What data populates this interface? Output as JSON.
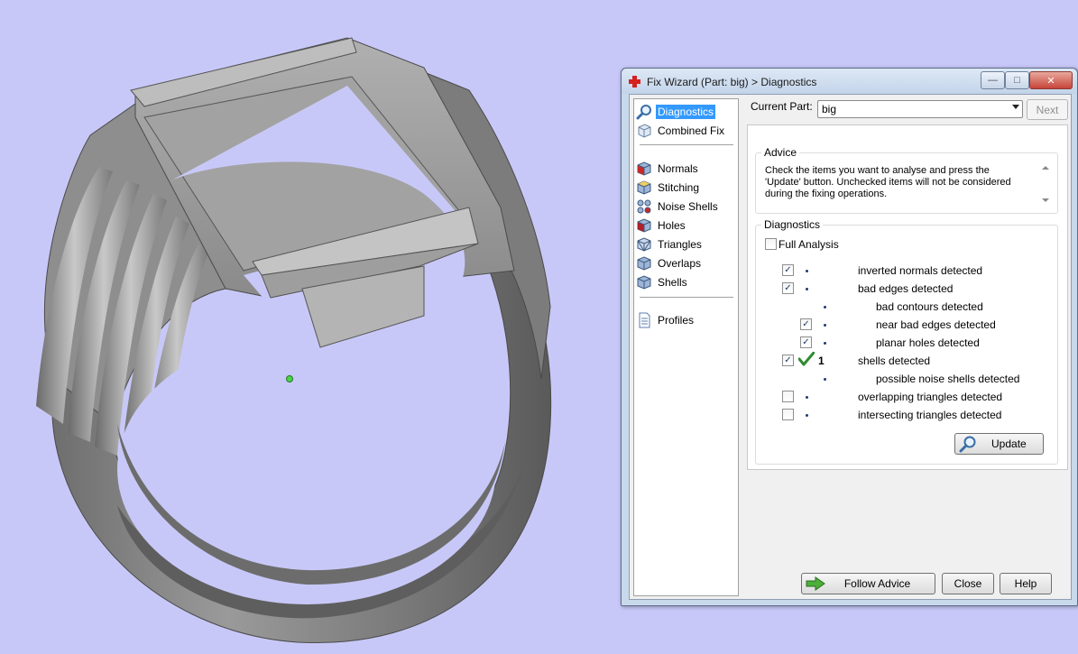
{
  "window": {
    "title": "Fix Wizard (Part: big) > Diagnostics",
    "controls": {
      "minimize": "—",
      "maximize": "□",
      "close": "✕"
    }
  },
  "nav": {
    "items": [
      {
        "label": "Diagnostics",
        "icon": "magnifier-icon",
        "selected": true
      },
      {
        "label": "Combined Fix",
        "icon": "combined-fix-icon"
      },
      {
        "label": "Normals",
        "icon": "normals-cube-icon"
      },
      {
        "label": "Stitching",
        "icon": "stitching-cube-icon"
      },
      {
        "label": "Noise Shells",
        "icon": "noise-shells-icon"
      },
      {
        "label": "Holes",
        "icon": "holes-cube-icon"
      },
      {
        "label": "Triangles",
        "icon": "triangles-cube-icon"
      },
      {
        "label": "Overlaps",
        "icon": "overlaps-cube-icon"
      },
      {
        "label": "Shells",
        "icon": "shells-cube-icon"
      },
      {
        "label": "Profiles",
        "icon": "profiles-document-icon"
      }
    ]
  },
  "header": {
    "current_part_label": "Current Part:",
    "current_part_value": "big",
    "next_label": "Next"
  },
  "advice": {
    "title": "Advice",
    "text": "Check the items you want to analyse and press the 'Update' button. Unchecked items will not be considered during the fixing operations."
  },
  "diagnostics": {
    "title": "Diagnostics",
    "full_analysis_label": "Full Analysis",
    "full_analysis_checked": false,
    "rows": [
      {
        "label": "inverted normals detected",
        "checked": true,
        "indent": 0,
        "count": ""
      },
      {
        "label": "bad edges detected",
        "checked": true,
        "indent": 0,
        "count": ""
      },
      {
        "label": "bad contours detected",
        "checked": null,
        "indent": 1,
        "count": ""
      },
      {
        "label": "near bad edges detected",
        "checked": true,
        "indent": 1,
        "count": ""
      },
      {
        "label": "planar holes detected",
        "checked": true,
        "indent": 1,
        "count": ""
      },
      {
        "label": "shells detected",
        "checked": true,
        "indent": 0,
        "count": "1",
        "ok": true
      },
      {
        "label": "possible noise shells detected",
        "checked": null,
        "indent": 1,
        "count": ""
      },
      {
        "label": "overlapping triangles detected",
        "checked": false,
        "indent": 0,
        "count": ""
      },
      {
        "label": "intersecting triangles detected",
        "checked": false,
        "indent": 0,
        "count": ""
      }
    ],
    "update_label": "Update"
  },
  "footer": {
    "follow_advice_label": "Follow Advice",
    "close_label": "Close",
    "help_label": "Help"
  },
  "colors": {
    "background": "#c8c8f8",
    "selection": "#3399ff",
    "check_green": "#2e8b2e",
    "ring_gray": "#8a8a8a"
  }
}
